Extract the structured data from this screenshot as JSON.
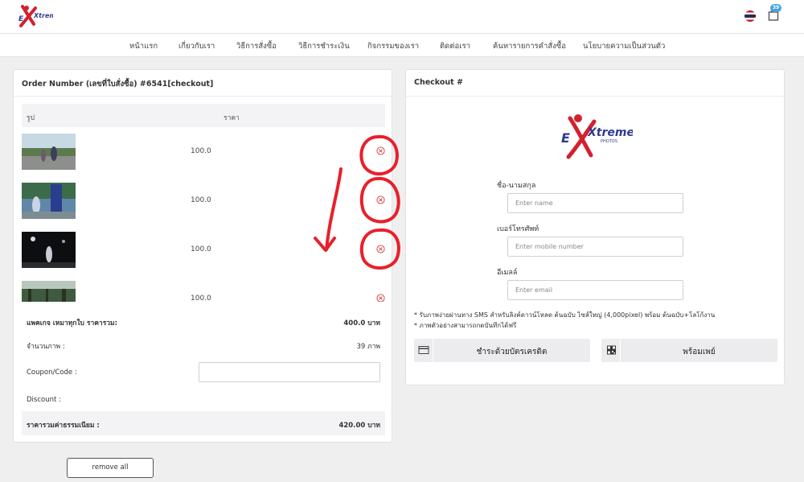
{
  "header": {
    "logo_text": "Xtreme",
    "logo_subtext": "PHOTOS",
    "cart_count": "39",
    "icons": [
      "thai-flag-icon",
      "cart-icon"
    ]
  },
  "nav": {
    "items": [
      "หน้าแรก",
      "เกี่ยวกับเรา",
      "วิธีการสั่งซื้อ",
      "วิธีการชำระเงิน",
      "กิจกรรมของเรา",
      "ติดต่อเรา",
      "ค้นหารายการคำสั่งซื้อ",
      "นโยบายความเป็นส่วนตัว"
    ]
  },
  "order": {
    "title": "Order Number (เลขที่ใบสั่งซื้อ) #6541[checkout]",
    "col_image": "รูป",
    "col_price": "ราคา",
    "items": [
      {
        "price": "100.0"
      },
      {
        "price": "100.0"
      },
      {
        "price": "100.0"
      },
      {
        "price": "100.0"
      }
    ],
    "package_label": "แพคเกจ เหมาทุกใบ ราคารวม:",
    "package_value": "400.0 บาท",
    "count_label": "จำนวนภาพ :",
    "count_value": "39 ภาพ",
    "coupon_label": "Coupon/Code :",
    "coupon_value": "",
    "discount_label": "Discount :",
    "total_label": "ราคารวมค่าธรรมเนียม :",
    "total_value": "420.00 บาท",
    "remove_all_label": "remove all"
  },
  "checkout": {
    "title": "Checkout #",
    "name_label": "ชื่อ-นามสกุล",
    "name_placeholder": "Enter name",
    "mobile_label": "เบอร์โทรศัพท์",
    "mobile_placeholder": "Enter mobile number",
    "email_label": "อีเมลล์",
    "email_placeholder": "Enter email",
    "note1": "* รับภาพง่ายผ่านทาง SMS สำหรับลิงค์ดาวน์โหลด ต้นฉบับ ไซส์ใหญ่ (4,000pixel) พร้อม ต้นฉบับ+โลโก้งาน",
    "note2": "* ภาพตัวอย่างสามารถกดบันทึกได้ฟรี",
    "pay_card_label": "ชำระด้วยบัตรเครดิต",
    "pay_promptpay_label": "พร้อมเพย์"
  },
  "colors": {
    "brand_red": "#d3202f",
    "brand_blue": "#2f3b8f",
    "badge_blue": "#4aa3df",
    "annotation_red": "#e8202a"
  }
}
